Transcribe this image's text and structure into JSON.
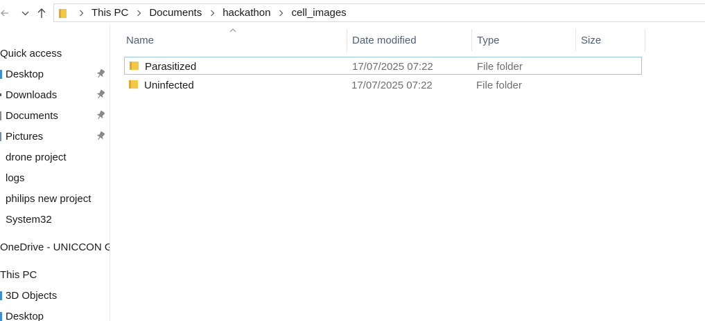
{
  "navigation": {
    "back_icon": "back-arrow-icon",
    "forward_icon": "forward-arrow-icon",
    "recent_icon": "chevron-down-icon",
    "up_icon": "up-arrow-icon"
  },
  "address_bar": {
    "breadcrumbs": [
      "This PC",
      "Documents",
      "hackathon",
      "cell_images"
    ]
  },
  "sidebar": {
    "quick_access": "Quick access",
    "pinned_items": [
      "Desktop",
      "Downloads",
      "Documents",
      "Pictures"
    ],
    "recent_items": [
      "drone project",
      "logs",
      "philips new project",
      "System32"
    ],
    "onedrive": "OneDrive - UNICCON GI",
    "this_pc": "This PC",
    "this_pc_items": [
      "3D Objects",
      "Desktop"
    ]
  },
  "columns": {
    "name": "Name",
    "date_modified": "Date modified",
    "type": "Type",
    "size": "Size"
  },
  "files": [
    {
      "name": "Parasitized",
      "date": "17/07/2025 07:22",
      "type": "File folder",
      "size": "",
      "selected": true
    },
    {
      "name": "Uninfected",
      "date": "17/07/2025 07:22",
      "type": "File folder",
      "size": "",
      "selected": false
    }
  ],
  "colors": {
    "folder": "#f5c842",
    "selection_border": "#99c9e8",
    "header_text": "#4c607a",
    "secondary_text": "#6d6d6d"
  }
}
